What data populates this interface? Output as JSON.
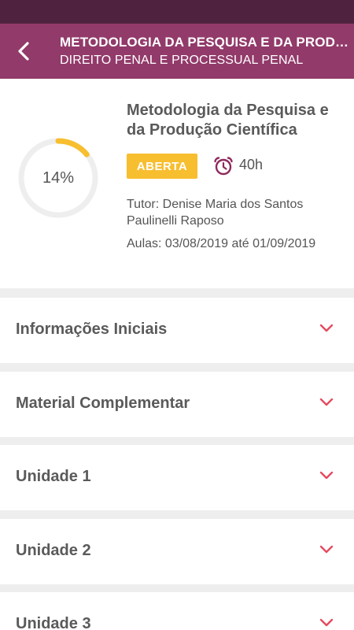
{
  "header": {
    "title": "METODOLOGIA DA PESQUISA E DA PRODUÇÃO CIENTÍFICA",
    "subtitle": "DIREITO PENAL E PROCESSUAL PENAL",
    "back_icon": "chevron-left-icon"
  },
  "course": {
    "progress_label": "14%",
    "progress_fraction": 0.14,
    "title": "Metodologia da Pesquisa e da Produção Científica",
    "status": "ABERTA",
    "hours": "40h",
    "tutor": "Tutor: Denise Maria dos Santos Paulinelli Raposo",
    "aulas": "Aulas: 03/08/2019 até 01/09/2019"
  },
  "sections": [
    {
      "label": "Informações Iniciais"
    },
    {
      "label": "Material Complementar"
    },
    {
      "label": "Unidade 1"
    },
    {
      "label": "Unidade 2"
    },
    {
      "label": "Unidade 3"
    }
  ],
  "colors": {
    "status_bar": "#4f2340",
    "app_bar": "#923a6a",
    "progress": "#f7be2f",
    "badge": "#f7be2f",
    "chevron": "#e44b5f",
    "alarm": "#8e2a5e"
  }
}
